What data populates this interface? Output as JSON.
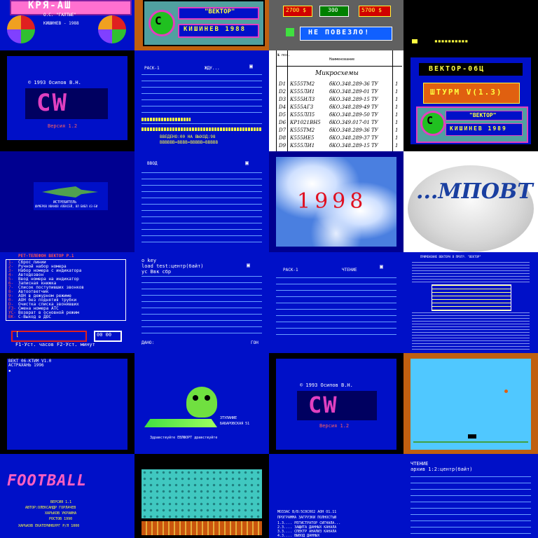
{
  "colors": {
    "screen_blue": "#0010c8",
    "navy": "#000090",
    "dark_blue": "#00007a",
    "cyan": "#50c8ff",
    "magenta": "#e040c0",
    "yellow": "#ffff40",
    "orange": "#e87810",
    "green": "#40e040"
  },
  "t01": {
    "logo": "КРЯ-АШ",
    "line1": "О.С. \"ГАЛТЫЕ\"",
    "line2": "КИШИНЕВ - 1988"
  },
  "t02": {
    "badge_small": "\"ВЕКТОР\"",
    "badge_big": "КИШИНЕВ 1988",
    "icon": "copyright-c-icon"
  },
  "t03": {
    "score1": "2700 $",
    "score2": "300",
    "score3": "5700 $",
    "message": "НЕ ПОВЕЗЛО!"
  },
  "t04": {
    "text": "▪▪▪▪▪▪▪▪▪▪"
  },
  "t05": {
    "copyright": "© 1993 Осипов В.Н.",
    "logo": "CW",
    "version": "Версия 1.2"
  },
  "t06": {
    "header_left": "РАСК-1",
    "header_mid": "ЖДУ...",
    "header_right": "▣",
    "footer1": "ВВЕДЕНО:00   НА ВЫХОД:98",
    "footer2": "ВВВВВВ=ВВВВ=ВВВВВ=ВВВВВ"
  },
  "t07": {
    "col_no": "№ поз.",
    "col_name": "Наименование",
    "title": "Микросхемы",
    "rows": [
      {
        "n": "D1",
        "code": "К555ТМ2",
        "spec": "бКО.348.289-36 ТУ",
        "q": "1"
      },
      {
        "n": "D2",
        "code": "К555ЛИ1",
        "spec": "бКО.348.289-01 ТУ",
        "q": "1"
      },
      {
        "n": "D3",
        "code": "К555ИЛ3",
        "spec": "бКО.348.289-15 ТУ",
        "q": "1"
      },
      {
        "n": "D4",
        "code": "К555АГ3",
        "spec": "бКО.348.289-49 ТУ",
        "q": "1"
      },
      {
        "n": "D5",
        "code": "К555ЛП5",
        "spec": "бКО.348.289-50 ТУ",
        "q": "1"
      },
      {
        "n": "D6",
        "code": "КР1021ВН5",
        "spec": "бКО.349.017-01 ТУ",
        "q": "1"
      },
      {
        "n": "D7",
        "code": "К555ТМ2",
        "spec": "бКО.348.289-36 ТУ",
        "q": "1"
      },
      {
        "n": "D8",
        "code": "К555ИЕ5",
        "spec": "бКО.348.289-37 ТУ",
        "q": "1"
      },
      {
        "n": "D9",
        "code": "К555ЛИ1",
        "spec": "бКО.348.289-15 ТУ",
        "q": "1"
      }
    ]
  },
  "t08": {
    "title": "ВЕКТОР-06Ц",
    "mid": "ШТУРМ V(1.3)",
    "badge_small": "\"ВЕКТОР\"",
    "badge_big": "КИШИНЕВ 1989"
  },
  "t10": {
    "header_left": "ВВОД",
    "header_right": "▣"
  },
  "t11": {
    "caption1": "ИСТРЕБИТЕЛЬ",
    "caption2": "ШУМЕРОВ ИВАНОВ АЛЕКСЕЙ, ВЛ БИБЛ 43-БИ"
  },
  "t12": {
    "year": "1998"
  },
  "t13": {
    "logo": "...МПОВТ"
  },
  "t14": {
    "title": "РЕТ-ТЕЛЕФОН ВЕКТОР Р.1",
    "menu": [
      {
        "key": "1-",
        "label": "Сброс линии"
      },
      {
        "key": "2-",
        "label": "Ручной набор номера"
      },
      {
        "key": "3-",
        "label": "Набор номера с индикатора"
      },
      {
        "key": "4-",
        "label": "Автодозвон"
      },
      {
        "key": "5-",
        "label": "Ввод номера на индикатор"
      },
      {
        "key": "6-",
        "label": "Записная книжка"
      },
      {
        "key": "7-",
        "label": "Список поступивших звонков"
      },
      {
        "key": "8-",
        "label": "Автоответчик"
      },
      {
        "key": "9-",
        "label": "АОН в дежурном режиме"
      },
      {
        "key": "0-",
        "label": "АОН без поднятия трубки"
      },
      {
        "key": "D-",
        "label": "Очистка списка звонивших"
      },
      {
        "key": "F3-",
        "label": "Смена номера АТС"
      },
      {
        "key": "УС-",
        "label": "Возврат в основной режим"
      },
      {
        "key": "ВК-",
        "label": "С-Выход в ДОС"
      }
    ],
    "input": "[",
    "counter": "00 00",
    "footer": "F1-Уст. часов  F2-Уст. минут"
  },
  "t15": {
    "line1": "o key",
    "line2": "load test:центр(байт)",
    "line3": "ус  Ввк сбр",
    "header_right": "▣",
    "footer_left": "ДАНО:",
    "footer_right": "ГОН"
  },
  "t16": {
    "header_left": "РАСК-1",
    "header_mid": "ЧТЕНИЕ",
    "header_right": "▣"
  },
  "t17": {
    "title": "ПРИМЕНЕНИЕ ВЕКТОРА В ПРОГР. \"ВЕКТОР\""
  },
  "t18": {
    "line1": "ВЕКТ 06-КТИМ V1.0",
    "line2": "АСТРАХАНЬ 1996",
    "line3": "▪"
  },
  "t19": {
    "right1": "ЗТУЛАНИЕ",
    "right2": "БАБАРОВСКАЯ 51",
    "bottom": "Здравствуйте ЕВЛФОРТ дравствуйте",
    "icon": "green-alien-icon"
  },
  "t20": {
    "copyright": "© 1993 Осипов В.Н.",
    "logo": "CW",
    "version": "Версия 1.2"
  },
  "t22": {
    "logo": "FOOTBALL",
    "l1": "ВЕРСИЯ 1.1",
    "l2": "АВТОР:ОЛЕКСАНДР ГОРЛАЧЕВ",
    "l3": "ХАРЬКОВ  УКРАИНА",
    "l4": "РОСТОВ  1990",
    "l5": "ХАРЬКОВ  ЕКАТЕРИНБУРГ  Р/Л 1000"
  },
  "t24": {
    "l1": "МОЗЗАС В/В:5С0С0О2  АОН О1.11",
    "l2": "ПРОГРАММА ЗАГРУЗКИ ПОЛНОСТЬЮ",
    "m1": "1.3....  РЕГИСТРАТОР СИГНАЛА...",
    "m2": "2.3....  ЗАЩИТА ДАННЫХ КАНАЛА",
    "m3": "3.3....  СПЕКТР АНАЛИЗ КАНАЛА",
    "m4": "4.3....  ВЫВОД ДАННЫХ",
    "m5": "5.3....  СЕРВИС ОБРАБОТКИ"
  },
  "t25": {
    "line1": "ЧТЕНИЕ",
    "line2": "архив 1:2:центр(байт)"
  }
}
